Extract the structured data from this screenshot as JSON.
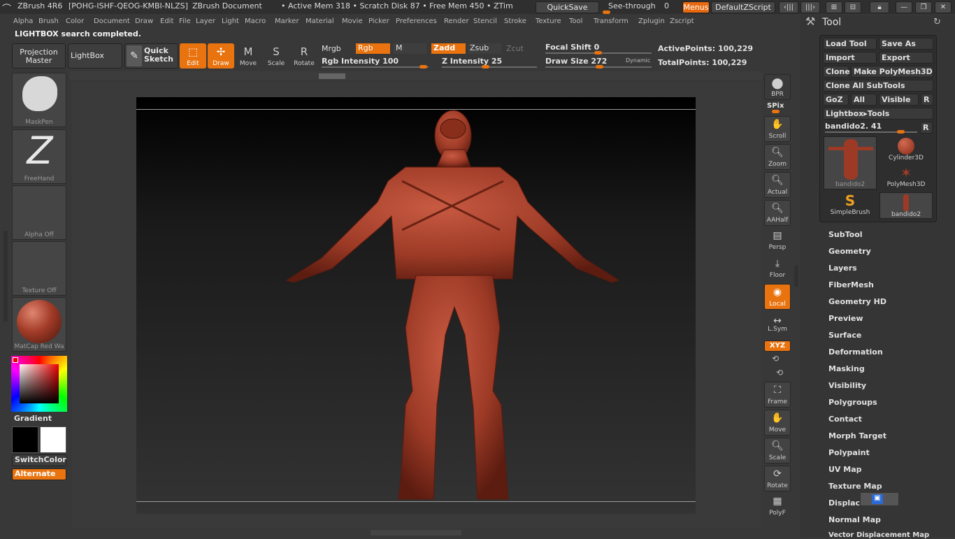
{
  "title": {
    "app": "ZBrush 4R6",
    "serial": "[POHG-ISHF-QEOG-KMBI-NLZS]",
    "doc": "ZBrush Document",
    "mem": "• Active Mem 318 • Scratch Disk 87 • Free Mem 450 • ZTim"
  },
  "topbuttons": {
    "quicksave": "QuickSave",
    "seethrough": "See-through",
    "seethrough_val": "0",
    "menus": "Menus",
    "zscript": "DefaultZScript"
  },
  "menu": [
    "Alpha",
    "Brush",
    "Color",
    "Document",
    "Draw",
    "Edit",
    "File",
    "Layer",
    "Light",
    "Macro",
    "Marker",
    "Material",
    "Movie",
    "Picker",
    "Preferences",
    "Render",
    "Stencil",
    "Stroke",
    "Texture",
    "Tool",
    "Transform",
    "Zplugin",
    "Zscript"
  ],
  "status": "LIGHTBOX search completed.",
  "shelf": {
    "projection_master": "Projection Master",
    "lightbox": "LightBox",
    "quick_sketch": "Quick Sketch",
    "edit": "Edit",
    "draw": "Draw",
    "move": "Move",
    "scale": "Scale",
    "rotate": "Rotate"
  },
  "brushopts": {
    "mrgb": "Mrgb",
    "rgb": "Rgb",
    "m": "M",
    "zadd": "Zadd",
    "zsub": "Zsub",
    "zcut": "Zcut",
    "rgb_intensity": "Rgb Intensity 100",
    "z_intensity": "Z Intensity 25",
    "focal_shift": "Focal Shift 0",
    "draw_size": "Draw Size 272",
    "dynamic": "Dynamic",
    "active_points": "ActivePoints: 100,229",
    "total_points": "TotalPoints: 100,229"
  },
  "leftpanel": {
    "maskpen": "MaskPen",
    "freehand": "FreeHand",
    "alpha": "Alpha Off",
    "texture": "Texture Off",
    "material": "MatCap Red Wa",
    "gradient": "Gradient",
    "switchcolor": "SwitchColor",
    "alternate": "Alternate"
  },
  "righttools": {
    "bpr": "BPR",
    "spix": "SPix",
    "scroll": "Scroll",
    "zoom": "Zoom",
    "actual": "Actual",
    "aahalf": "AAHalf",
    "persp": "Persp",
    "floor": "Floor",
    "local": "Local",
    "lsym": "L.Sym",
    "xyz": "XYZ",
    "frame": "Frame",
    "move": "Move",
    "scale": "Scale",
    "rotate": "Rotate",
    "polyf": "PolyF"
  },
  "toolpanel": {
    "title": "Tool",
    "load_tool": "Load Tool",
    "save_as": "Save As",
    "import": "Import",
    "export": "Export",
    "clone": "Clone",
    "make_polymesh": "Make PolyMesh3D",
    "clone_all": "Clone All SubTools",
    "goz": "GoZ",
    "all": "All",
    "visible": "Visible",
    "r": "R",
    "lightbox_tools": "Lightbox▸Tools",
    "tool_name": "bandido2. 41",
    "thumbs": [
      "bandido2",
      "Cylinder3D",
      "PolyMesh3D",
      "SimpleBrush",
      "bandido2"
    ]
  },
  "sections": [
    "SubTool",
    "Geometry",
    "Layers",
    "FiberMesh",
    "Geometry HD",
    "Preview",
    "Surface",
    "Deformation",
    "Masking",
    "Visibility",
    "Polygroups",
    "Contact",
    "Morph Target",
    "Polypaint",
    "UV Map",
    "Texture Map",
    "Displace",
    "Normal Map",
    "Vector Displacement Map"
  ],
  "colors": {
    "accent": "#e8730f",
    "bg": "#383838",
    "model": "#a23c28"
  }
}
